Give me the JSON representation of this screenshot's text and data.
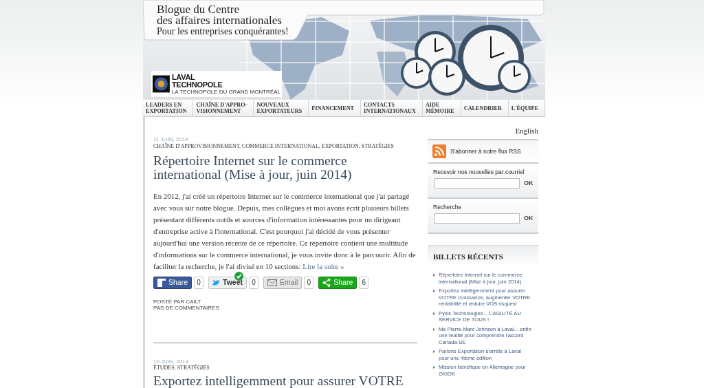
{
  "header": {
    "title_lines": [
      "Blogue du Centre",
      "des affaires internationales"
    ],
    "tagline": "Pour les entreprises conquérantes!",
    "logo": {
      "name_lines": [
        "LAVAL",
        "TECHNOPOLE"
      ],
      "subtitle": "LA TECHNOPOLE DU GRAND MONTRÉAL"
    }
  },
  "nav": [
    {
      "lines": [
        "LEADERS EN",
        "EXPORTATION"
      ]
    },
    {
      "lines": [
        "CHAÎNE D'APPRO-",
        "VISIONNEMENT"
      ]
    },
    {
      "lines": [
        "NOUVEAUX",
        "EXPORTATEURS"
      ]
    },
    {
      "lines": [
        "FINANCEMENT"
      ]
    },
    {
      "lines": [
        "CONTACTS",
        "INTERNATIONAUX"
      ]
    },
    {
      "lines": [
        "AIDE",
        "MÉMOIRE"
      ]
    },
    {
      "lines": [
        "CALENDRIER"
      ]
    },
    {
      "lines": [
        "L'ÉQUIPE"
      ]
    }
  ],
  "language_link": "English",
  "posts": [
    {
      "date": "11 JUIN, 2014",
      "categories": "CHAÎNE D'APPROVISIONNEMENT, COMMERCE INTERNATIONAL, EXPORTATION, STRATÉGIES",
      "title": "Répertoire Internet sur le commerce international (Mise à jour, juin 2014)",
      "body": "En 2012, j'ai créé un répertoire Internet sur le commerce international que j'ai partagé avec vous sur notre blogue. Depuis, mes collègues et moi avons écrit plusieurs billets présentant différents outils et sources d'information intéressantes pour un dirigeant d'entreprise active à l'international. C'est pourquoi j'ai décidé de vous présenter aujourd'hui une version récente de ce répertoire. Ce répertoire contient une multitude d'informations sur le commerce international, je vous invite donc à le parcourir. Afin de faciliter la recherche, je l'ai divisé en 10 sections:",
      "read_more": "Lire la suite »",
      "share_buttons": [
        {
          "kind": "facebook",
          "label": "Share",
          "count": "0",
          "badge": false
        },
        {
          "kind": "twitter",
          "label": "Tweet",
          "count": "0",
          "badge": true
        },
        {
          "kind": "email",
          "label": "Email",
          "count": "0",
          "badge": false
        },
        {
          "kind": "share",
          "label": "Share",
          "count": "6",
          "badge": false
        }
      ],
      "posted_by": "POSTÉ PAR CAILT",
      "comments": "PAS DE COMMENTAIRES"
    },
    {
      "date": "10 JUIN, 2014",
      "categories": "ÉTUDES, STRATÉGIES",
      "title": "Exportez intelligemment pour assurer VOTRE"
    }
  ],
  "sidebar": {
    "rss_label": "S'abonner à notre flux RSS",
    "newsletter": {
      "label": "Recevoir nos nouvelles par courriel",
      "button": "OK"
    },
    "search": {
      "label": "Recherche",
      "button": "OK"
    },
    "recent": {
      "heading": "BILLETS RÉCENTS",
      "items": [
        "Répertoire Internet sur le commerce international (Mise à jour, juin 2014)",
        "Exportez intelligemment pour assurer VOTRE croissance, augmenter VOTRE rentabilité et réduire VOS risques!",
        "Pyxis Technologies – L'AGILITÉ AU SERVICE DE TOUS !",
        "Me Pierre-Marc Johnson à Laval... enfin une réalité pour comprendre l'accord Canada-UE",
        "Parlons Exportation s'arrête à Laval pour une 4ième édition",
        "Mission bénéfique en Allemagne pour OKIOK"
      ]
    }
  }
}
